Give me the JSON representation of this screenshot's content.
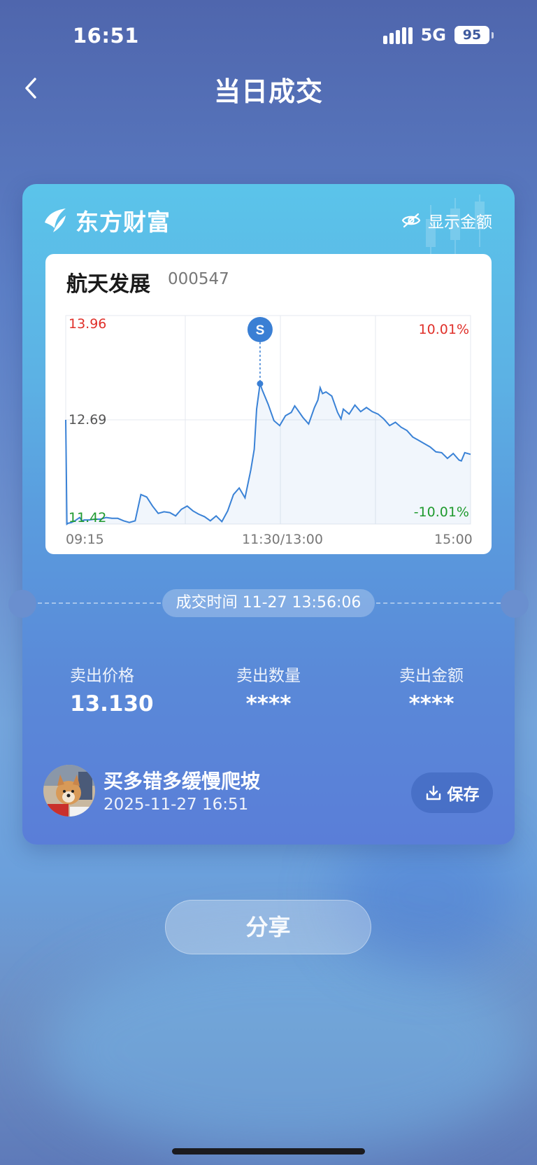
{
  "status_bar": {
    "time": "16:51",
    "network": "5G",
    "battery": "95"
  },
  "header": {
    "title": "当日成交"
  },
  "card": {
    "brand": "东方财富",
    "show_amount_label": "显示金额",
    "stock": {
      "name": "航天发展",
      "code": "000547"
    },
    "deal_time_label": "成交时间 11-27 13:56:06",
    "stats": [
      {
        "label": "卖出价格",
        "value": "13.130"
      },
      {
        "label": "卖出数量",
        "value": "****"
      },
      {
        "label": "卖出金额",
        "value": "****"
      }
    ],
    "user": {
      "name": "买多错多缓慢爬坡",
      "time": "2025-11-27 16:51"
    },
    "save_label": "保存"
  },
  "share_label": "分享",
  "colors": {
    "up": "#e0302a",
    "down": "#1f9a2e",
    "line": "#3a82d6",
    "marker": "#3a7fd4"
  },
  "chart_data": {
    "type": "line",
    "y_labels": {
      "max": "13.96",
      "mid": "12.69",
      "min": "11.42"
    },
    "pct_labels": {
      "max": "10.01%",
      "min": "-10.01%"
    },
    "x_labels": [
      "09:15",
      "11:30/13:00",
      "15:00"
    ],
    "ylim": [
      11.42,
      13.96
    ],
    "marker": {
      "label": "S",
      "time": "13:56",
      "price": 13.13
    },
    "series": [
      {
        "x": [
          0,
          1,
          2,
          5,
          8,
          12,
          14,
          16,
          20,
          25,
          30,
          35,
          40,
          45,
          50,
          55,
          60,
          65,
          70,
          75,
          80,
          85,
          90,
          95,
          100,
          105,
          110,
          115,
          120,
          125,
          130,
          135,
          140,
          145,
          150,
          155,
          160,
          163,
          165,
          168,
          170,
          175,
          180,
          185,
          190,
          195,
          198,
          200,
          205,
          210,
          215,
          218,
          220,
          222,
          225,
          230,
          235,
          238,
          240,
          245,
          250,
          255,
          260,
          265,
          270,
          275,
          280,
          285,
          290,
          295,
          300,
          305,
          310,
          315,
          320,
          325,
          330,
          335,
          340,
          342,
          345,
          350
        ],
        "y": [
          12.69,
          11.42,
          11.43,
          11.44,
          11.46,
          11.5,
          11.46,
          11.47,
          11.47,
          11.48,
          11.48,
          11.5,
          11.49,
          11.49,
          11.46,
          11.44,
          11.46,
          11.78,
          11.75,
          11.64,
          11.55,
          11.57,
          11.56,
          11.52,
          11.6,
          11.64,
          11.58,
          11.54,
          11.51,
          11.46,
          11.52,
          11.45,
          11.58,
          11.78,
          11.86,
          11.74,
          12.08,
          12.33,
          12.82,
          13.13,
          13.05,
          12.88,
          12.68,
          12.62,
          12.74,
          12.78,
          12.86,
          12.82,
          12.72,
          12.64,
          12.84,
          12.93,
          13.08,
          13.01,
          13.03,
          12.98,
          12.78,
          12.7,
          12.82,
          12.76,
          12.87,
          12.79,
          12.84,
          12.79,
          12.76,
          12.7,
          12.62,
          12.66,
          12.6,
          12.56,
          12.48,
          12.44,
          12.4,
          12.36,
          12.3,
          12.29,
          12.22,
          12.28,
          12.2,
          12.19,
          12.29,
          12.27
        ]
      }
    ]
  }
}
